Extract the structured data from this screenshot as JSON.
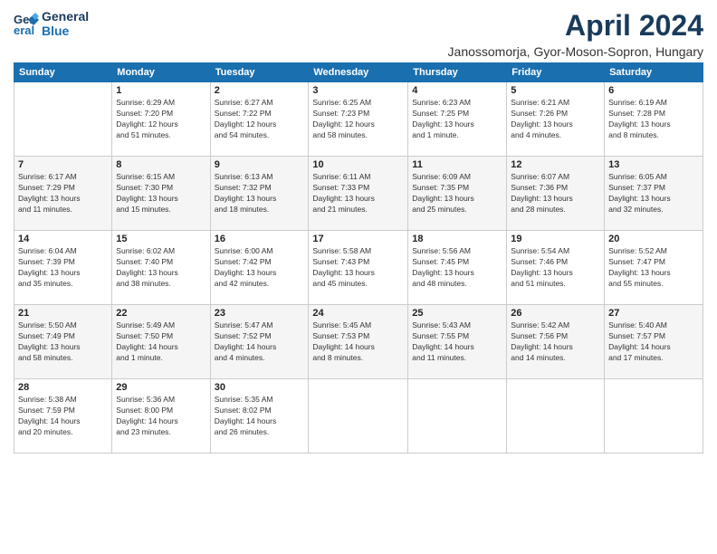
{
  "logo": {
    "line1": "General",
    "line2": "Blue"
  },
  "title": "April 2024",
  "location": "Janossomorja, Gyor-Moson-Sopron, Hungary",
  "weekdays": [
    "Sunday",
    "Monday",
    "Tuesday",
    "Wednesday",
    "Thursday",
    "Friday",
    "Saturday"
  ],
  "weeks": [
    [
      {
        "day": "",
        "info": ""
      },
      {
        "day": "1",
        "info": "Sunrise: 6:29 AM\nSunset: 7:20 PM\nDaylight: 12 hours\nand 51 minutes."
      },
      {
        "day": "2",
        "info": "Sunrise: 6:27 AM\nSunset: 7:22 PM\nDaylight: 12 hours\nand 54 minutes."
      },
      {
        "day": "3",
        "info": "Sunrise: 6:25 AM\nSunset: 7:23 PM\nDaylight: 12 hours\nand 58 minutes."
      },
      {
        "day": "4",
        "info": "Sunrise: 6:23 AM\nSunset: 7:25 PM\nDaylight: 13 hours\nand 1 minute."
      },
      {
        "day": "5",
        "info": "Sunrise: 6:21 AM\nSunset: 7:26 PM\nDaylight: 13 hours\nand 4 minutes."
      },
      {
        "day": "6",
        "info": "Sunrise: 6:19 AM\nSunset: 7:28 PM\nDaylight: 13 hours\nand 8 minutes."
      }
    ],
    [
      {
        "day": "7",
        "info": "Sunrise: 6:17 AM\nSunset: 7:29 PM\nDaylight: 13 hours\nand 11 minutes."
      },
      {
        "day": "8",
        "info": "Sunrise: 6:15 AM\nSunset: 7:30 PM\nDaylight: 13 hours\nand 15 minutes."
      },
      {
        "day": "9",
        "info": "Sunrise: 6:13 AM\nSunset: 7:32 PM\nDaylight: 13 hours\nand 18 minutes."
      },
      {
        "day": "10",
        "info": "Sunrise: 6:11 AM\nSunset: 7:33 PM\nDaylight: 13 hours\nand 21 minutes."
      },
      {
        "day": "11",
        "info": "Sunrise: 6:09 AM\nSunset: 7:35 PM\nDaylight: 13 hours\nand 25 minutes."
      },
      {
        "day": "12",
        "info": "Sunrise: 6:07 AM\nSunset: 7:36 PM\nDaylight: 13 hours\nand 28 minutes."
      },
      {
        "day": "13",
        "info": "Sunrise: 6:05 AM\nSunset: 7:37 PM\nDaylight: 13 hours\nand 32 minutes."
      }
    ],
    [
      {
        "day": "14",
        "info": "Sunrise: 6:04 AM\nSunset: 7:39 PM\nDaylight: 13 hours\nand 35 minutes."
      },
      {
        "day": "15",
        "info": "Sunrise: 6:02 AM\nSunset: 7:40 PM\nDaylight: 13 hours\nand 38 minutes."
      },
      {
        "day": "16",
        "info": "Sunrise: 6:00 AM\nSunset: 7:42 PM\nDaylight: 13 hours\nand 42 minutes."
      },
      {
        "day": "17",
        "info": "Sunrise: 5:58 AM\nSunset: 7:43 PM\nDaylight: 13 hours\nand 45 minutes."
      },
      {
        "day": "18",
        "info": "Sunrise: 5:56 AM\nSunset: 7:45 PM\nDaylight: 13 hours\nand 48 minutes."
      },
      {
        "day": "19",
        "info": "Sunrise: 5:54 AM\nSunset: 7:46 PM\nDaylight: 13 hours\nand 51 minutes."
      },
      {
        "day": "20",
        "info": "Sunrise: 5:52 AM\nSunset: 7:47 PM\nDaylight: 13 hours\nand 55 minutes."
      }
    ],
    [
      {
        "day": "21",
        "info": "Sunrise: 5:50 AM\nSunset: 7:49 PM\nDaylight: 13 hours\nand 58 minutes."
      },
      {
        "day": "22",
        "info": "Sunrise: 5:49 AM\nSunset: 7:50 PM\nDaylight: 14 hours\nand 1 minute."
      },
      {
        "day": "23",
        "info": "Sunrise: 5:47 AM\nSunset: 7:52 PM\nDaylight: 14 hours\nand 4 minutes."
      },
      {
        "day": "24",
        "info": "Sunrise: 5:45 AM\nSunset: 7:53 PM\nDaylight: 14 hours\nand 8 minutes."
      },
      {
        "day": "25",
        "info": "Sunrise: 5:43 AM\nSunset: 7:55 PM\nDaylight: 14 hours\nand 11 minutes."
      },
      {
        "day": "26",
        "info": "Sunrise: 5:42 AM\nSunset: 7:56 PM\nDaylight: 14 hours\nand 14 minutes."
      },
      {
        "day": "27",
        "info": "Sunrise: 5:40 AM\nSunset: 7:57 PM\nDaylight: 14 hours\nand 17 minutes."
      }
    ],
    [
      {
        "day": "28",
        "info": "Sunrise: 5:38 AM\nSunset: 7:59 PM\nDaylight: 14 hours\nand 20 minutes."
      },
      {
        "day": "29",
        "info": "Sunrise: 5:36 AM\nSunset: 8:00 PM\nDaylight: 14 hours\nand 23 minutes."
      },
      {
        "day": "30",
        "info": "Sunrise: 5:35 AM\nSunset: 8:02 PM\nDaylight: 14 hours\nand 26 minutes."
      },
      {
        "day": "",
        "info": ""
      },
      {
        "day": "",
        "info": ""
      },
      {
        "day": "",
        "info": ""
      },
      {
        "day": "",
        "info": ""
      }
    ]
  ]
}
